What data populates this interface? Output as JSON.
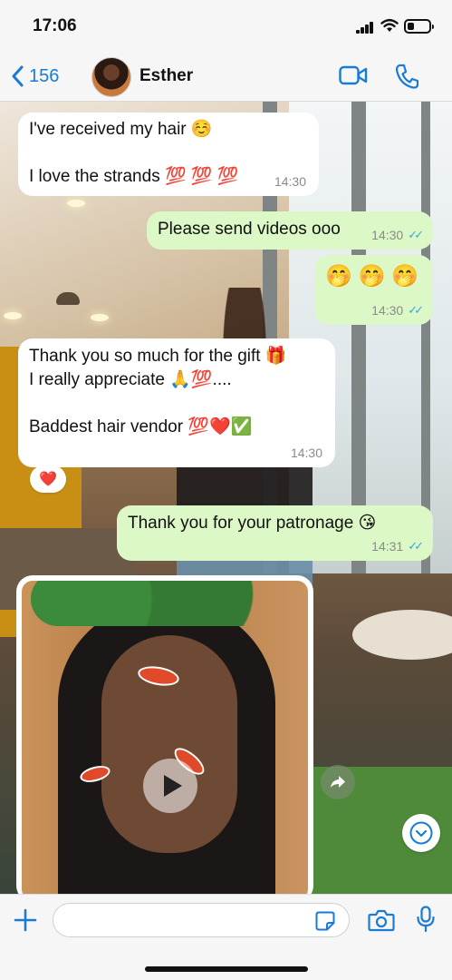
{
  "status_bar": {
    "time": "17:06"
  },
  "header": {
    "back_count": "156",
    "contact_name": "Esther"
  },
  "messages": [
    {
      "dir": "in",
      "lines": [
        "I've received my hair ☺️",
        "",
        "I love the strands 💯 💯 💯"
      ],
      "time": "14:30"
    },
    {
      "dir": "out",
      "lines": [
        "Please send videos ooo"
      ],
      "time": "14:30",
      "status": "read"
    },
    {
      "dir": "out",
      "lines": [
        "🤭 🤭 🤭"
      ],
      "time": "14:30",
      "status": "read"
    },
    {
      "dir": "in",
      "lines": [
        "Thank you so much for the gift 🎁",
        "I really appreciate 🙏💯....",
        "",
        "Baddest hair vendor 💯❤️✅"
      ],
      "time": "14:30",
      "reaction": "❤️"
    },
    {
      "dir": "out",
      "lines": [
        "Thank you for your patronage 😘"
      ],
      "time": "14:31",
      "status": "read"
    }
  ],
  "video_message": {
    "type": "video"
  },
  "input_bar": {
    "placeholder": "",
    "value": ""
  },
  "colors": {
    "accent": "#1a7bd6",
    "outgoing_bubble": "#dcf8c6",
    "incoming_bubble": "#ffffff",
    "read_ticks": "#3aa7e8"
  },
  "icons": [
    "back-chevron-icon",
    "video-call-icon",
    "phone-icon",
    "play-icon",
    "forward-icon",
    "chevron-down-icon",
    "plus-icon",
    "sticker-icon",
    "camera-icon",
    "microphone-icon"
  ]
}
